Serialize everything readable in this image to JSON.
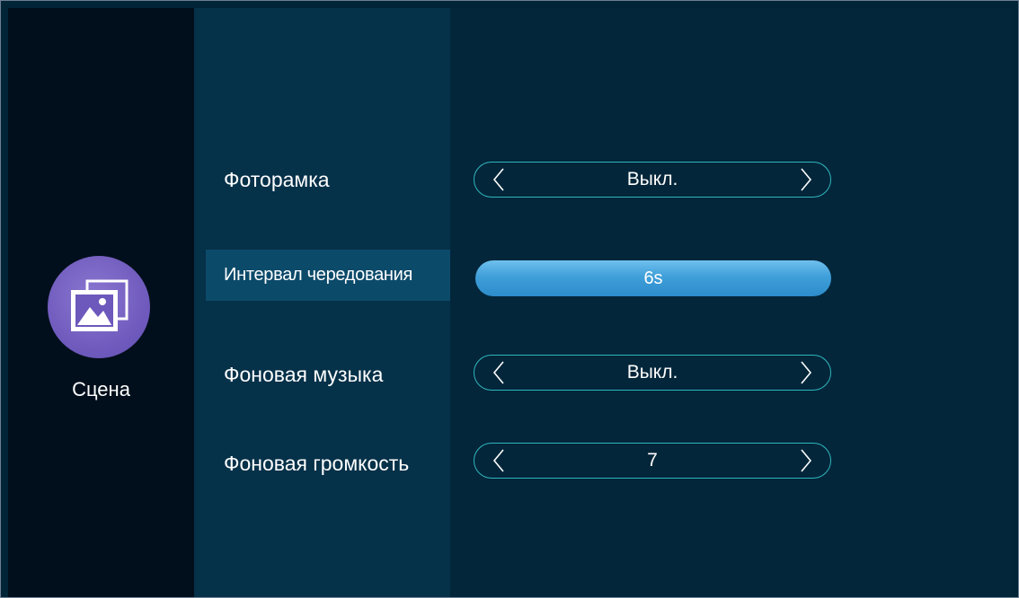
{
  "sidebar": {
    "section_label": "Сцена",
    "section_icon": "gallery-icon",
    "icon_color": "#6d58bb"
  },
  "settings": [
    {
      "label": "Фоторамка",
      "value": "Выкл."
    },
    {
      "label": "Интервал чередования",
      "value": "6s",
      "selected": true
    },
    {
      "label": "Фоновая музыка",
      "value": "Выкл."
    },
    {
      "label": "Фоновая громкость",
      "value": "7"
    }
  ],
  "colors": {
    "accent": "#2fb8bf",
    "active_value_bg": "#3f9fd9",
    "background": "#022437"
  }
}
